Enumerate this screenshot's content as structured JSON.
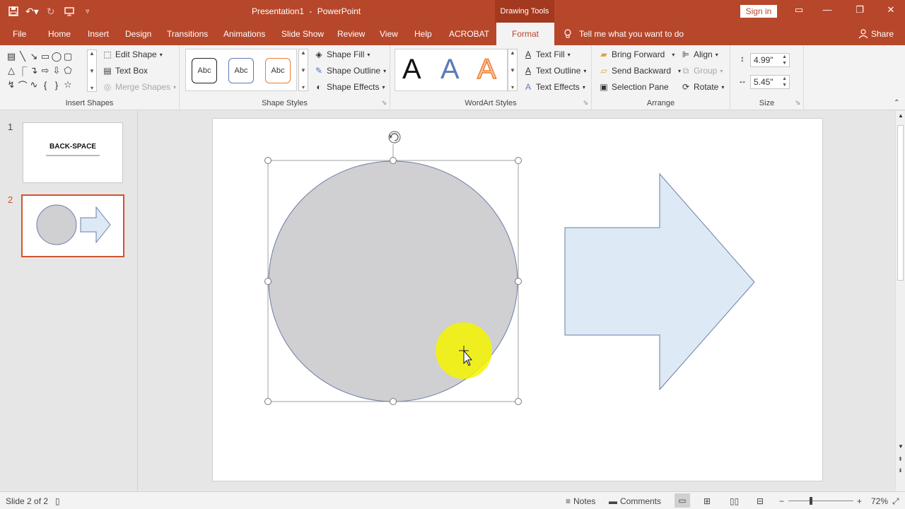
{
  "titlebar": {
    "doc_title": "Presentation1",
    "app_name": "PowerPoint",
    "title_separator": "-",
    "context_label": "Drawing Tools",
    "signin_label": "Sign in"
  },
  "tabs": [
    {
      "label": "File"
    },
    {
      "label": "Home"
    },
    {
      "label": "Insert"
    },
    {
      "label": "Design"
    },
    {
      "label": "Transitions"
    },
    {
      "label": "Animations"
    },
    {
      "label": "Slide Show"
    },
    {
      "label": "Review"
    },
    {
      "label": "View"
    },
    {
      "label": "Help"
    },
    {
      "label": "ACROBAT"
    },
    {
      "label": "Format"
    }
  ],
  "tellme": "Tell me what you want to do",
  "share": "Share",
  "ribbon": {
    "insert_shapes": {
      "label": "Insert Shapes",
      "edit_shape": "Edit Shape",
      "text_box": "Text Box",
      "merge_shapes": "Merge Shapes"
    },
    "shape_styles": {
      "label": "Shape Styles",
      "preset": "Abc",
      "shape_fill": "Shape Fill",
      "shape_outline": "Shape Outline",
      "shape_effects": "Shape Effects"
    },
    "wordart": {
      "label": "WordArt Styles",
      "letter": "A",
      "text_fill": "Text Fill",
      "text_outline": "Text Outline",
      "text_effects": "Text Effects"
    },
    "arrange": {
      "label": "Arrange",
      "bring_forward": "Bring Forward",
      "send_backward": "Send Backward",
      "selection_pane": "Selection Pane",
      "align": "Align",
      "group": "Group",
      "rotate": "Rotate"
    },
    "size": {
      "label": "Size",
      "height": "4.99\"",
      "width": "5.45\""
    }
  },
  "slides": [
    {
      "number": "1",
      "title": "BACK-SPACE"
    },
    {
      "number": "2"
    }
  ],
  "status": {
    "slide_info": "Slide 2 of 2",
    "notes": "Notes",
    "comments": "Comments",
    "zoom": "72%"
  },
  "colors": {
    "accent": "#b7472a",
    "circle_fill": "#d0cfd2",
    "circle_stroke": "#6b7ea8",
    "arrow_fill": "#dde9f4",
    "arrow_stroke": "#6b7ea8",
    "highlight": "#f4f400",
    "thumb_selected": "#d35230"
  },
  "icons": {
    "save": "save-icon",
    "undo": "undo-icon",
    "redo": "redo-icon",
    "start_from_beginning": "present-icon",
    "customize": "customize-qat-icon",
    "lightbulb": "lightbulb-icon",
    "user": "user-icon"
  }
}
